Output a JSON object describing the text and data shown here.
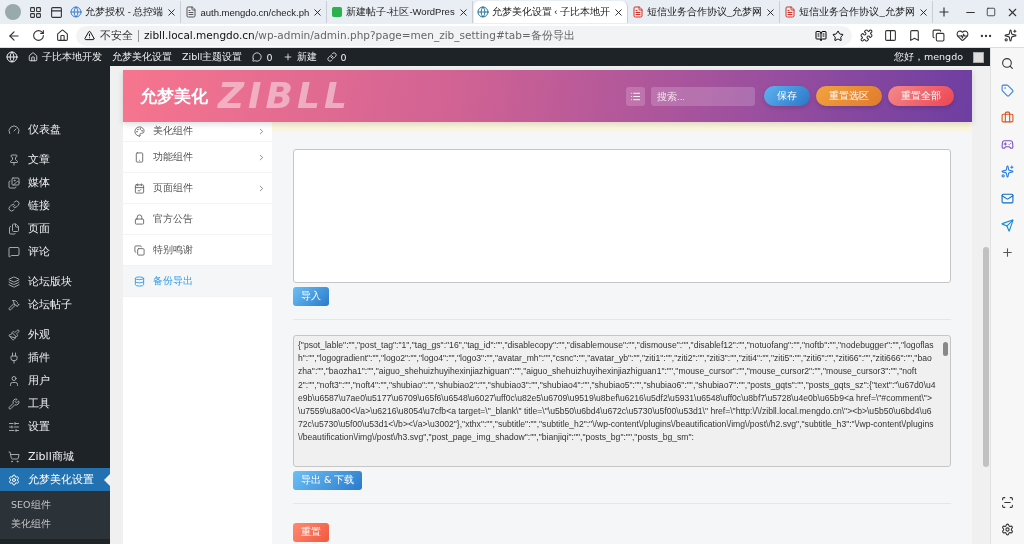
{
  "browser": {
    "tabs": [
      {
        "title": "允梦授权 - 总控端",
        "selected": false,
        "kind": "swirl"
      },
      {
        "title": "auth.mengdo.cn/check.ph",
        "selected": false,
        "kind": "doc"
      },
      {
        "title": "新建帖子-社区-WordPres",
        "selected": false,
        "kind": "green"
      },
      {
        "title": "允梦美化设置 ‹ 子比本地开",
        "selected": true,
        "kind": "wp"
      },
      {
        "title": "短信业务合作协议_允梦网",
        "selected": false,
        "kind": "pdf"
      },
      {
        "title": "短信业务合作协议_允梦网",
        "selected": false,
        "kind": "pdf"
      }
    ],
    "security": "不安全",
    "url_host": "zibll.local.mengdo.cn",
    "url_path": "/wp-admin/admin.php?page=men_zib_setting#tab=备份导出"
  },
  "admin_bar": {
    "site": "子比本地开发",
    "links": [
      "允梦美化设置",
      "Zibll主题设置"
    ],
    "comments": "0",
    "new": "新建",
    "link_count": "0",
    "greeting": "您好，mengdo"
  },
  "admin_menu": {
    "groups": [
      [
        {
          "label": "仪表盘",
          "selected": false
        }
      ],
      [
        {
          "label": "文章",
          "selected": false
        },
        {
          "label": "媒体",
          "selected": false
        },
        {
          "label": "链接",
          "selected": false
        },
        {
          "label": "页面",
          "selected": false
        },
        {
          "label": "评论",
          "selected": false
        }
      ],
      [
        {
          "label": "论坛版块",
          "selected": false
        },
        {
          "label": "论坛帖子",
          "selected": false
        }
      ],
      [
        {
          "label": "外观",
          "selected": false
        },
        {
          "label": "插件",
          "selected": false
        },
        {
          "label": "用户",
          "selected": false
        },
        {
          "label": "工具",
          "selected": false
        },
        {
          "label": "设置",
          "selected": false
        }
      ],
      [
        {
          "label": "Zibll商城",
          "selected": false
        },
        {
          "label": "允梦美化设置",
          "selected": true
        }
      ]
    ],
    "submenu": [
      "SEO组件",
      "美化组件"
    ]
  },
  "plugin": {
    "title": "允梦美化",
    "watermark": "ZIBLL",
    "search_placeholder": "搜索...",
    "buttons": [
      {
        "label": "保存",
        "kind": "save"
      },
      {
        "label": "重置选区",
        "kind": "reset_section"
      },
      {
        "label": "重置全部",
        "kind": "reset_all"
      }
    ],
    "nav": [
      {
        "label": "美化组件",
        "expandable": true,
        "selected": false
      },
      {
        "label": "功能组件",
        "expandable": true,
        "selected": false
      },
      {
        "label": "页面组件",
        "expandable": true,
        "selected": false
      },
      {
        "label": "官方公告",
        "expandable": false,
        "selected": false
      },
      {
        "label": "特别鸣谢",
        "expandable": false,
        "selected": false
      },
      {
        "label": "备份导出",
        "expandable": false,
        "selected": true
      }
    ],
    "import_button": "导入",
    "export_value": "{\"psot_lable\":\"\",\"post_tag\":\"1\",\"tag_gs\":\"16\",\"tag_id\":\"\",\"disablecopy\":\"\",\"disablemouse\":\"\",\"dismouse\":\"\",\"disablef12\":\"\",\"notuofang\":\"\",\"noftb\":\"\",\"nodebugger\":\"\",\"logoflash\":\"\",\"logogradient\":\"\",\"logo2\":\"\",\"logo4\":\"\",\"logo3\":\"\",\"avatar_mh\":\"\",\"csnc\":\"\",\"avatar_yb\":\"\",\"ziti1\":\"\",\"ziti2\":\"\",\"ziti3\":\"\",\"ziti4\":\"\",\"ziti5\":\"\",\"ziti6\":\"\",\"ziti66\":\"\",\"ziti666\":\"\",\"baozha\":\"\",\"baozha1\":\"\",\"aiguo_shehuizhuyihexinjiazhiguan\":\"\",\"aiguo_shehuizhuyihexinjiazhiguan1\":\"\",\"mouse_cursor\":\"\",\"mouse_cursor2\":\"\",\"mouse_cursor3\":\"\",\"noft2\":\"\",\"noft3\":\"\",\"noft4\":\"\",\"shubiao\":\"\",\"shubiao2\":\"\",\"shubiao3\":\"\",\"shubiao4\":\"\",\"shubiao5\":\"\",\"shubiao6\":\"\",\"shubiao7\":\"\",\"posts_gqts\":\"\",\"posts_gqts_sz\":{\"text\":\"\\u67d0\\u4e9b\\u6587\\u7ae0\\u5177\\u6709\\u65f6\\u6548\\u6027\\uff0c\\u82e5\\u6709\\u9519\\u8bef\\u6216\\u5df2\\u5931\\u6548\\uff0c\\u8bf7\\u5728\\u4e0b\\u65b9<a href=\\\"#comment\\\">\\u7559\\u8a00<\\/a>\\u6216\\u8054\\u7cfb<a target=\\\"_blank\\\" title=\\\"\\u5b50\\u6bd4\\u672c\\u5730\\u5f00\\u53d1\\\" href=\\\"http:\\/\\/zibll.local.mengdo.cn\\\"><b>\\u5b50\\u6bd4\\u672c\\u5730\\u5f00\\u53d1<\\/b><\\/a>\\u3002\"},\"xthx\":\"\",\"subtitle\":\"\",\"subtitle_h2\":\"\\/wp-content\\/plugins\\/beautification\\/img\\/post\\/h2.svg\",\"subtitle_h3\":\"\\/wp-content\\/plugins\\/beautification\\/img\\/post\\/h3.svg\",\"post_page_img_shadow\":\"\",\"bianjiqi\":\"\",\"posts_bg\":\"\",\"posts_bg_sm\":",
    "export_button": "导出 & 下载",
    "reset_button": "重置"
  }
}
